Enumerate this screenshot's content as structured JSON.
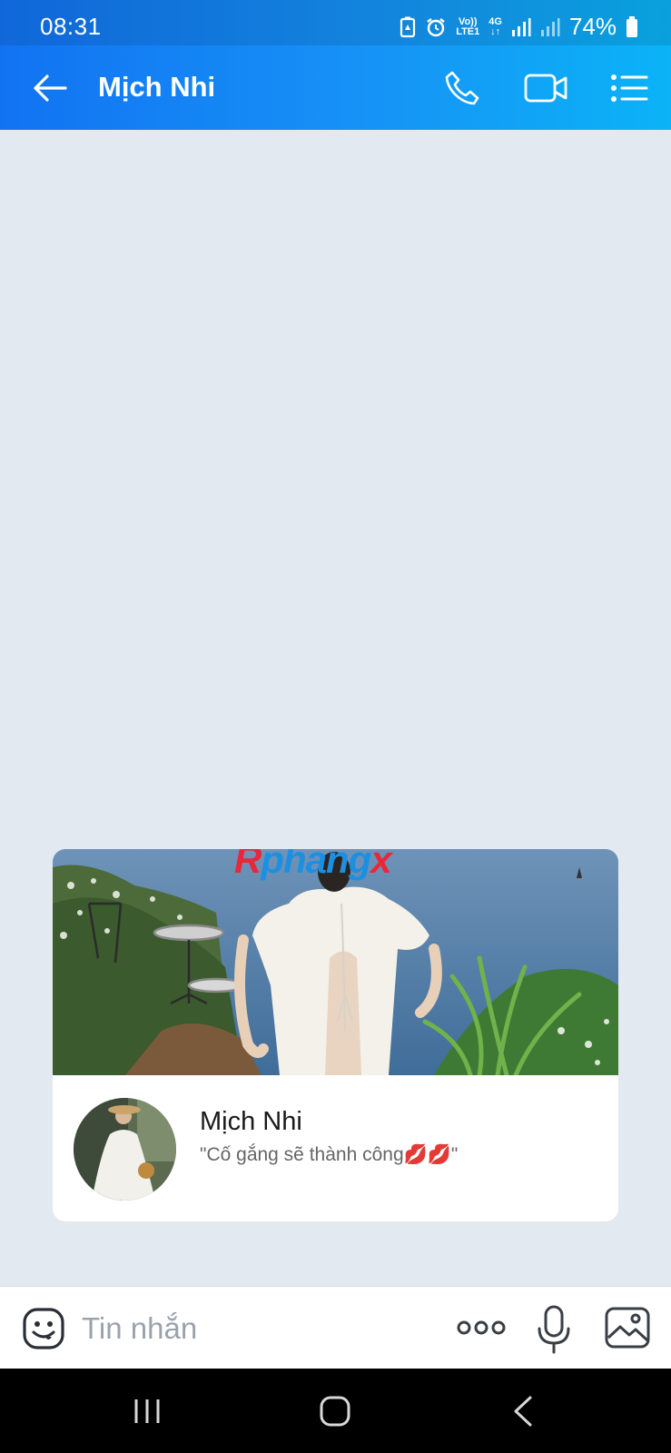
{
  "status_bar": {
    "time": "08:31",
    "network_label_top": "Vo))",
    "network_label_bottom": "LTE1",
    "network_type": "4G",
    "battery": "74%",
    "icons": [
      "battery-saver-icon",
      "alarm-icon",
      "volte-icon",
      "signal-icon",
      "signal-icon",
      "battery-icon"
    ]
  },
  "header": {
    "title": "Mịch Nhi",
    "icons": [
      "back-arrow-icon",
      "phone-call-icon",
      "video-call-icon",
      "menu-list-icon"
    ]
  },
  "profile_card": {
    "watermark": "Rphangx",
    "name": "Mịch Nhi",
    "status": "\"Cố gắng sẽ thành công💋💋\""
  },
  "composer": {
    "placeholder": "Tin nhắn",
    "icons": [
      "emoji-icon",
      "more-dots-icon",
      "microphone-icon",
      "image-icon"
    ]
  },
  "nav_bar": {
    "icons": [
      "recent-apps-icon",
      "home-icon",
      "back-icon"
    ]
  },
  "colors": {
    "header_start": "#1273f2",
    "header_end": "#0bb3f7",
    "chat_background": "#e2e9f1",
    "watermark_red": "#e8283a",
    "watermark_blue": "#1d8fe1"
  }
}
